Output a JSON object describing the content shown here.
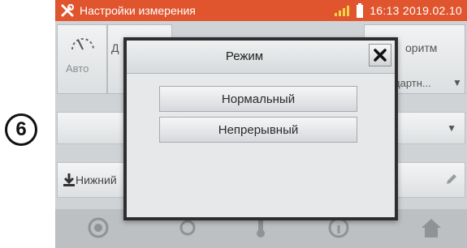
{
  "step_marker": "6",
  "status_bar": {
    "title": "Настройки измерения",
    "clock": "16:13 2019.02.10"
  },
  "tabs": {
    "auto_label": "Авто",
    "partial_d": "Д",
    "algorithm_partial": "оритм",
    "algorithm_value": "дартн..."
  },
  "row3": {
    "label": "Нижний"
  },
  "dialog": {
    "title": "Режим",
    "options": [
      "Нормальный",
      "Непрерывный"
    ]
  },
  "colors": {
    "status_bar": "#e0552e",
    "dialog_border": "#2e2e2e"
  }
}
